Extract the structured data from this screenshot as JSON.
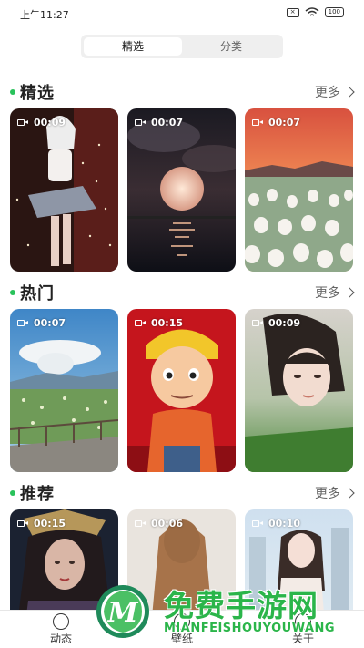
{
  "status_bar": {
    "time": "上午11:27",
    "battery": "100"
  },
  "segment": {
    "tabs": [
      {
        "label": "精选"
      },
      {
        "label": "分类"
      }
    ]
  },
  "sections": [
    {
      "title": "精选",
      "more": "更多",
      "cards": [
        {
          "duration": "00:09"
        },
        {
          "duration": "00:07"
        },
        {
          "duration": "00:07"
        }
      ]
    },
    {
      "title": "热门",
      "more": "更多",
      "cards": [
        {
          "duration": "00:07"
        },
        {
          "duration": "00:15"
        },
        {
          "duration": "00:09"
        }
      ]
    },
    {
      "title": "推荐",
      "more": "更多",
      "cards": [
        {
          "duration": "00:15"
        },
        {
          "duration": "00:06"
        },
        {
          "duration": "00:10"
        }
      ]
    }
  ],
  "bottom_nav": {
    "items": [
      {
        "label": "动态"
      },
      {
        "label": "壁纸"
      },
      {
        "label": "关于"
      }
    ]
  },
  "watermark": {
    "title": "免费手游网",
    "subtitle": "MIANFEISHOUYOUWANG"
  },
  "icons": {
    "video": "video-camera-icon",
    "more": "chevron-right-icon",
    "wifi": "wifi-icon",
    "battery": "battery-icon"
  },
  "colors": {
    "accent": "#29c25b",
    "watermark": "#2bb54a"
  }
}
